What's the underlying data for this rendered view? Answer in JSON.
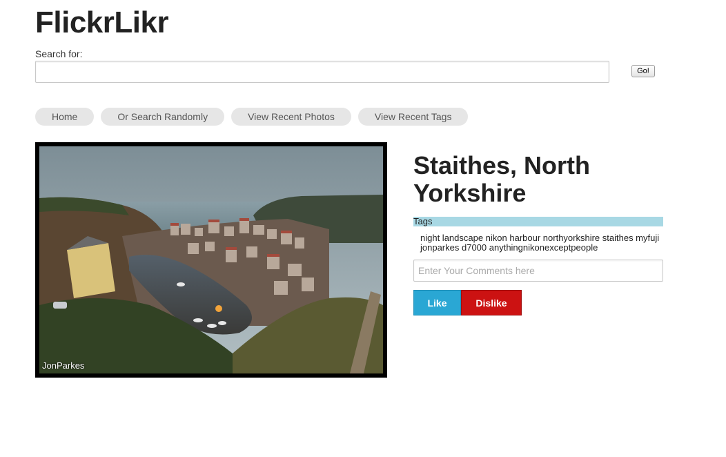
{
  "header": {
    "title": "FlickrLikr"
  },
  "search": {
    "label": "Search for:",
    "value": "",
    "placeholder": "",
    "go_label": "Go!"
  },
  "nav": {
    "items": [
      {
        "label": "Home"
      },
      {
        "label": "Or Search Randomly"
      },
      {
        "label": "View Recent Photos"
      },
      {
        "label": "View Recent Tags"
      }
    ]
  },
  "photo": {
    "watermark": "JonParkes",
    "title": "Staithes, North Yorkshire",
    "tags_header": "Tags",
    "tags": "night landscape nikon harbour northyorkshire staithes myfuji jonparkes d7000 anythingnikonexceptpeople"
  },
  "comment": {
    "placeholder": "Enter Your Comments here",
    "value": ""
  },
  "actions": {
    "like_label": "Like",
    "dislike_label": "Dislike",
    "like_color": "#2aa7d4",
    "dislike_color": "#cc1212"
  },
  "colors": {
    "tags_bg": "#a8d8e4",
    "nav_pill_bg": "#e6e6e6"
  }
}
